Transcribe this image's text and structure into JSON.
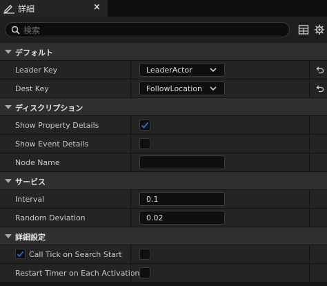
{
  "tab": {
    "title": "詳細",
    "close": "×",
    "icon": "pencil-icon"
  },
  "search": {
    "placeholder": "検索",
    "value": ""
  },
  "colors": {
    "accent": "#1f6fd1",
    "background": "#151515",
    "category": "#2f2f2f",
    "row": "#242424"
  },
  "categories": [
    {
      "label": "デフォルト",
      "rows": [
        {
          "name": "Leader Key",
          "type": "combo",
          "value": "LeaderActor",
          "reset": true
        },
        {
          "name": "Dest Key",
          "type": "combo",
          "value": "FollowLocation",
          "reset": true
        }
      ]
    },
    {
      "label": "ディスクリプション",
      "rows": [
        {
          "name": "Show Property Details",
          "type": "checkbox",
          "checked": true
        },
        {
          "name": "Show Event Details",
          "type": "checkbox",
          "checked": false
        },
        {
          "name": "Node Name",
          "type": "text",
          "value": ""
        }
      ]
    },
    {
      "label": "サービス",
      "rows": [
        {
          "name": "Interval",
          "type": "text",
          "value": "0.1"
        },
        {
          "name": "Random Deviation",
          "type": "text",
          "value": "0.02"
        }
      ]
    },
    {
      "label": "詳細設定",
      "rows": [
        {
          "name": "Call Tick on Search Start",
          "type": "checkbox",
          "checked": false,
          "inline_checked": true
        },
        {
          "name": "Restart Timer on Each Activation",
          "type": "checkbox",
          "checked": false
        }
      ]
    }
  ]
}
